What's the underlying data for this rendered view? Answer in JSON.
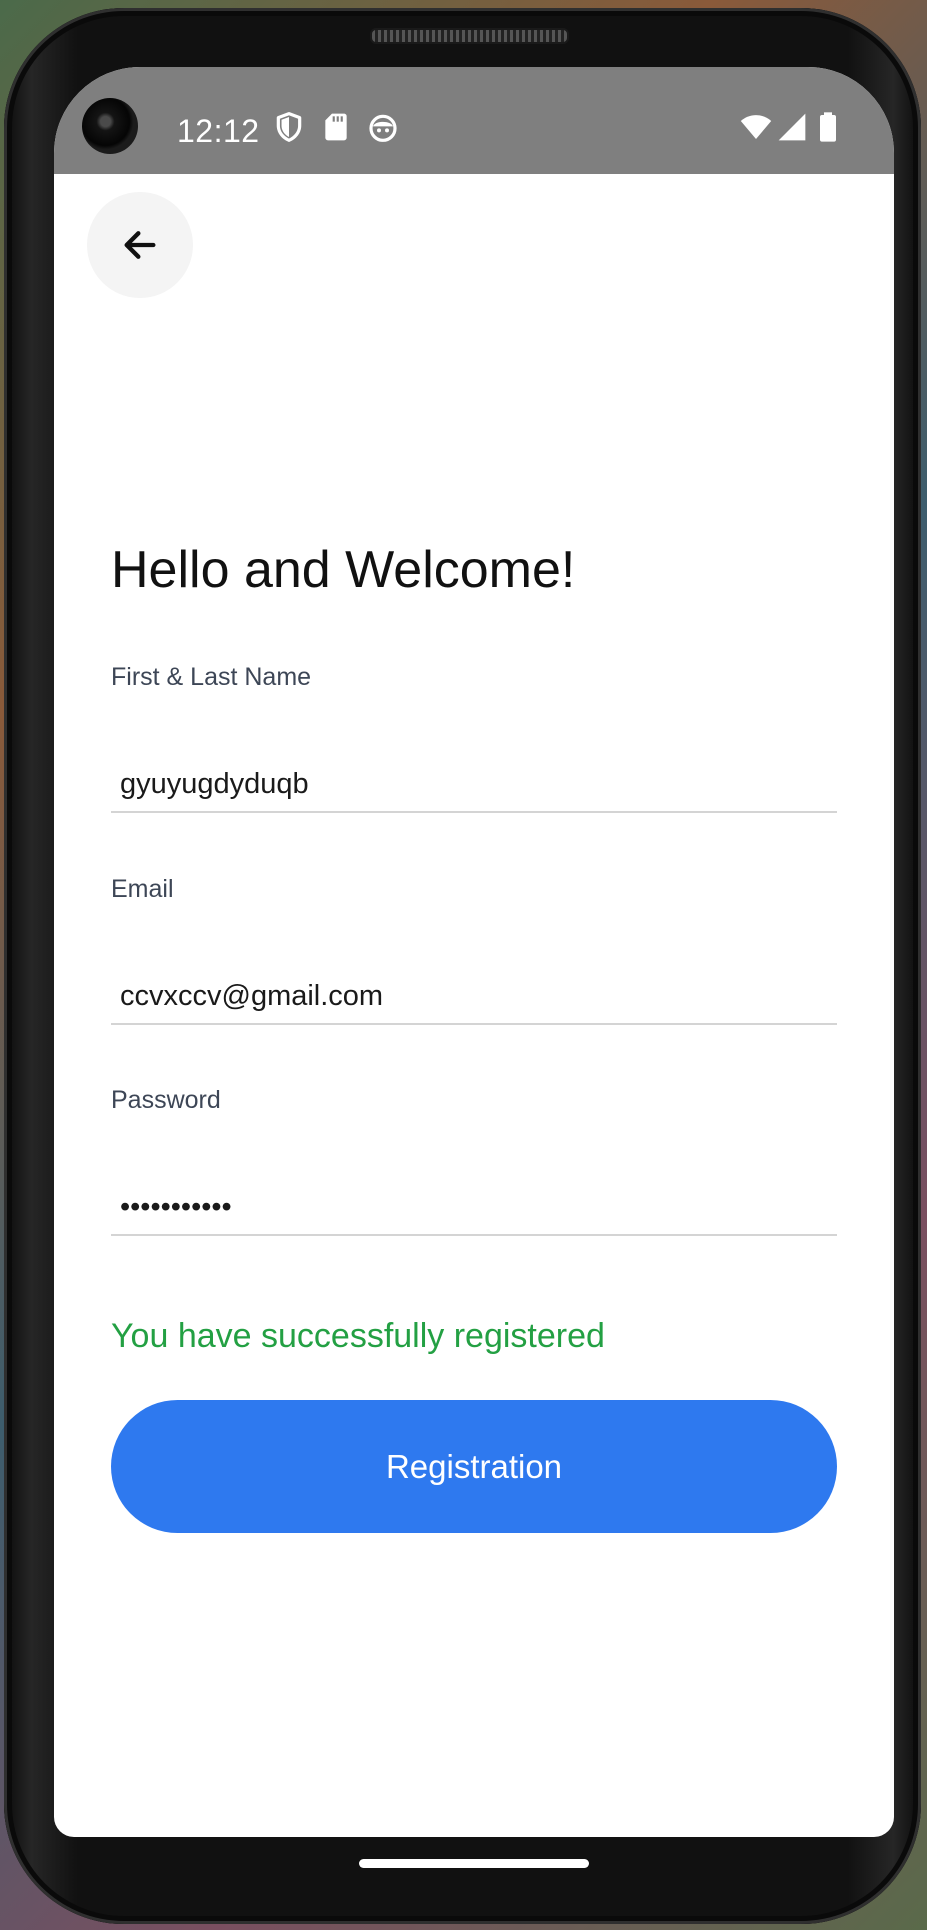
{
  "status_bar": {
    "time": "12:12",
    "icons": [
      "shield-icon",
      "sd-card-icon",
      "android-face-icon",
      "wifi-icon",
      "signal-icon",
      "battery-icon"
    ]
  },
  "header": {
    "back_icon": "arrow-left-icon"
  },
  "main": {
    "title": "Hello and Welcome!",
    "fields": [
      {
        "label": "First & Last Name",
        "value": "gyuyugdyduqb"
      },
      {
        "label": "Email",
        "value": "ccvxccv@gmail.com"
      },
      {
        "label": "Password",
        "value": "•••••••••••"
      }
    ],
    "success_message": "You have successfully registered",
    "register_label": "Registration"
  },
  "colors": {
    "accent": "#2e79ef",
    "success": "#23a043",
    "status_bar": "#7f7f7f"
  }
}
